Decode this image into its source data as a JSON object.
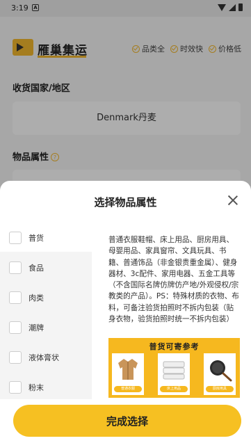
{
  "status_bar": {
    "time": "3:19",
    "notification_icon": "A"
  },
  "header": {
    "brand": "雁巢集运",
    "features": [
      "品类全",
      "时效快",
      "价格低"
    ]
  },
  "form": {
    "country_label": "收货国家/地区",
    "country_value": "Denmark丹麦",
    "attribute_label": "物品属性",
    "help_icon": "?"
  },
  "sheet": {
    "title": "选择物品属性",
    "categories": [
      "普货",
      "食品",
      "肉类",
      "潮牌",
      "液体膏状",
      "粉末"
    ],
    "description": "普通衣服鞋帽、床上用品、厨房用具、母婴用品、家具窗帘、文具玩具、书籍、普通饰品（非金银贵重金属）、健身器材、3c配件、家用电器、五金工具等（不含国际名牌仿牌仿产地/外观侵权/宗教类的产品）。PS：特殊材质的衣物、布料，可备注验货拍照时不拆内包装（贴身衣物，验货拍照时统一不拆内包装）",
    "reference": {
      "title": "普货可寄参考",
      "items": [
        "普通衣服",
        "床上用品",
        "厨房用具"
      ]
    },
    "confirm_label": "完成选择"
  }
}
